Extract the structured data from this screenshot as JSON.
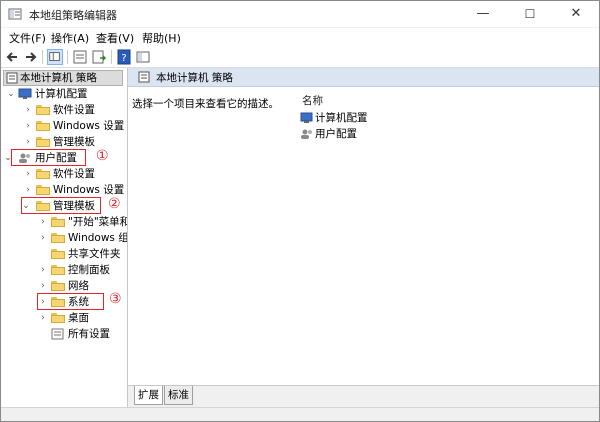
{
  "window": {
    "title": "本地组策略编辑器",
    "minimize": "—",
    "maximize": "☐",
    "close": "✕"
  },
  "menu": [
    "文件(F)",
    "操作(A)",
    "查看(V)",
    "帮助(H)"
  ],
  "tree": {
    "header": "本地计算机 策略",
    "computer_config": "计算机配置",
    "cc_software": "软件设置",
    "cc_windows": "Windows 设置",
    "cc_admin": "管理模板",
    "user_config": "用户配置",
    "uc_software": "软件设置",
    "uc_windows": "Windows 设置",
    "uc_admin": "管理模板",
    "start_menu": "\"开始\"菜单和",
    "windows_components": "Windows 组",
    "shared_folders": "共享文件夹",
    "control_panel": "控制面板",
    "network": "网络",
    "system": "系统",
    "desktop": "桌面",
    "all_settings": "所有设置"
  },
  "annotations": [
    "①",
    "②",
    "③"
  ],
  "right": {
    "header": "本地计算机 策略",
    "description": "选择一个项目来查看它的描述。",
    "column_name": "名称",
    "items": [
      "计算机配置",
      "用户配置"
    ]
  },
  "tabs": [
    "扩展",
    "标准"
  ],
  "colors": {
    "highlight": "#e0242b",
    "folder": "#f6d66e",
    "header_bg": "#dbe4f1"
  }
}
